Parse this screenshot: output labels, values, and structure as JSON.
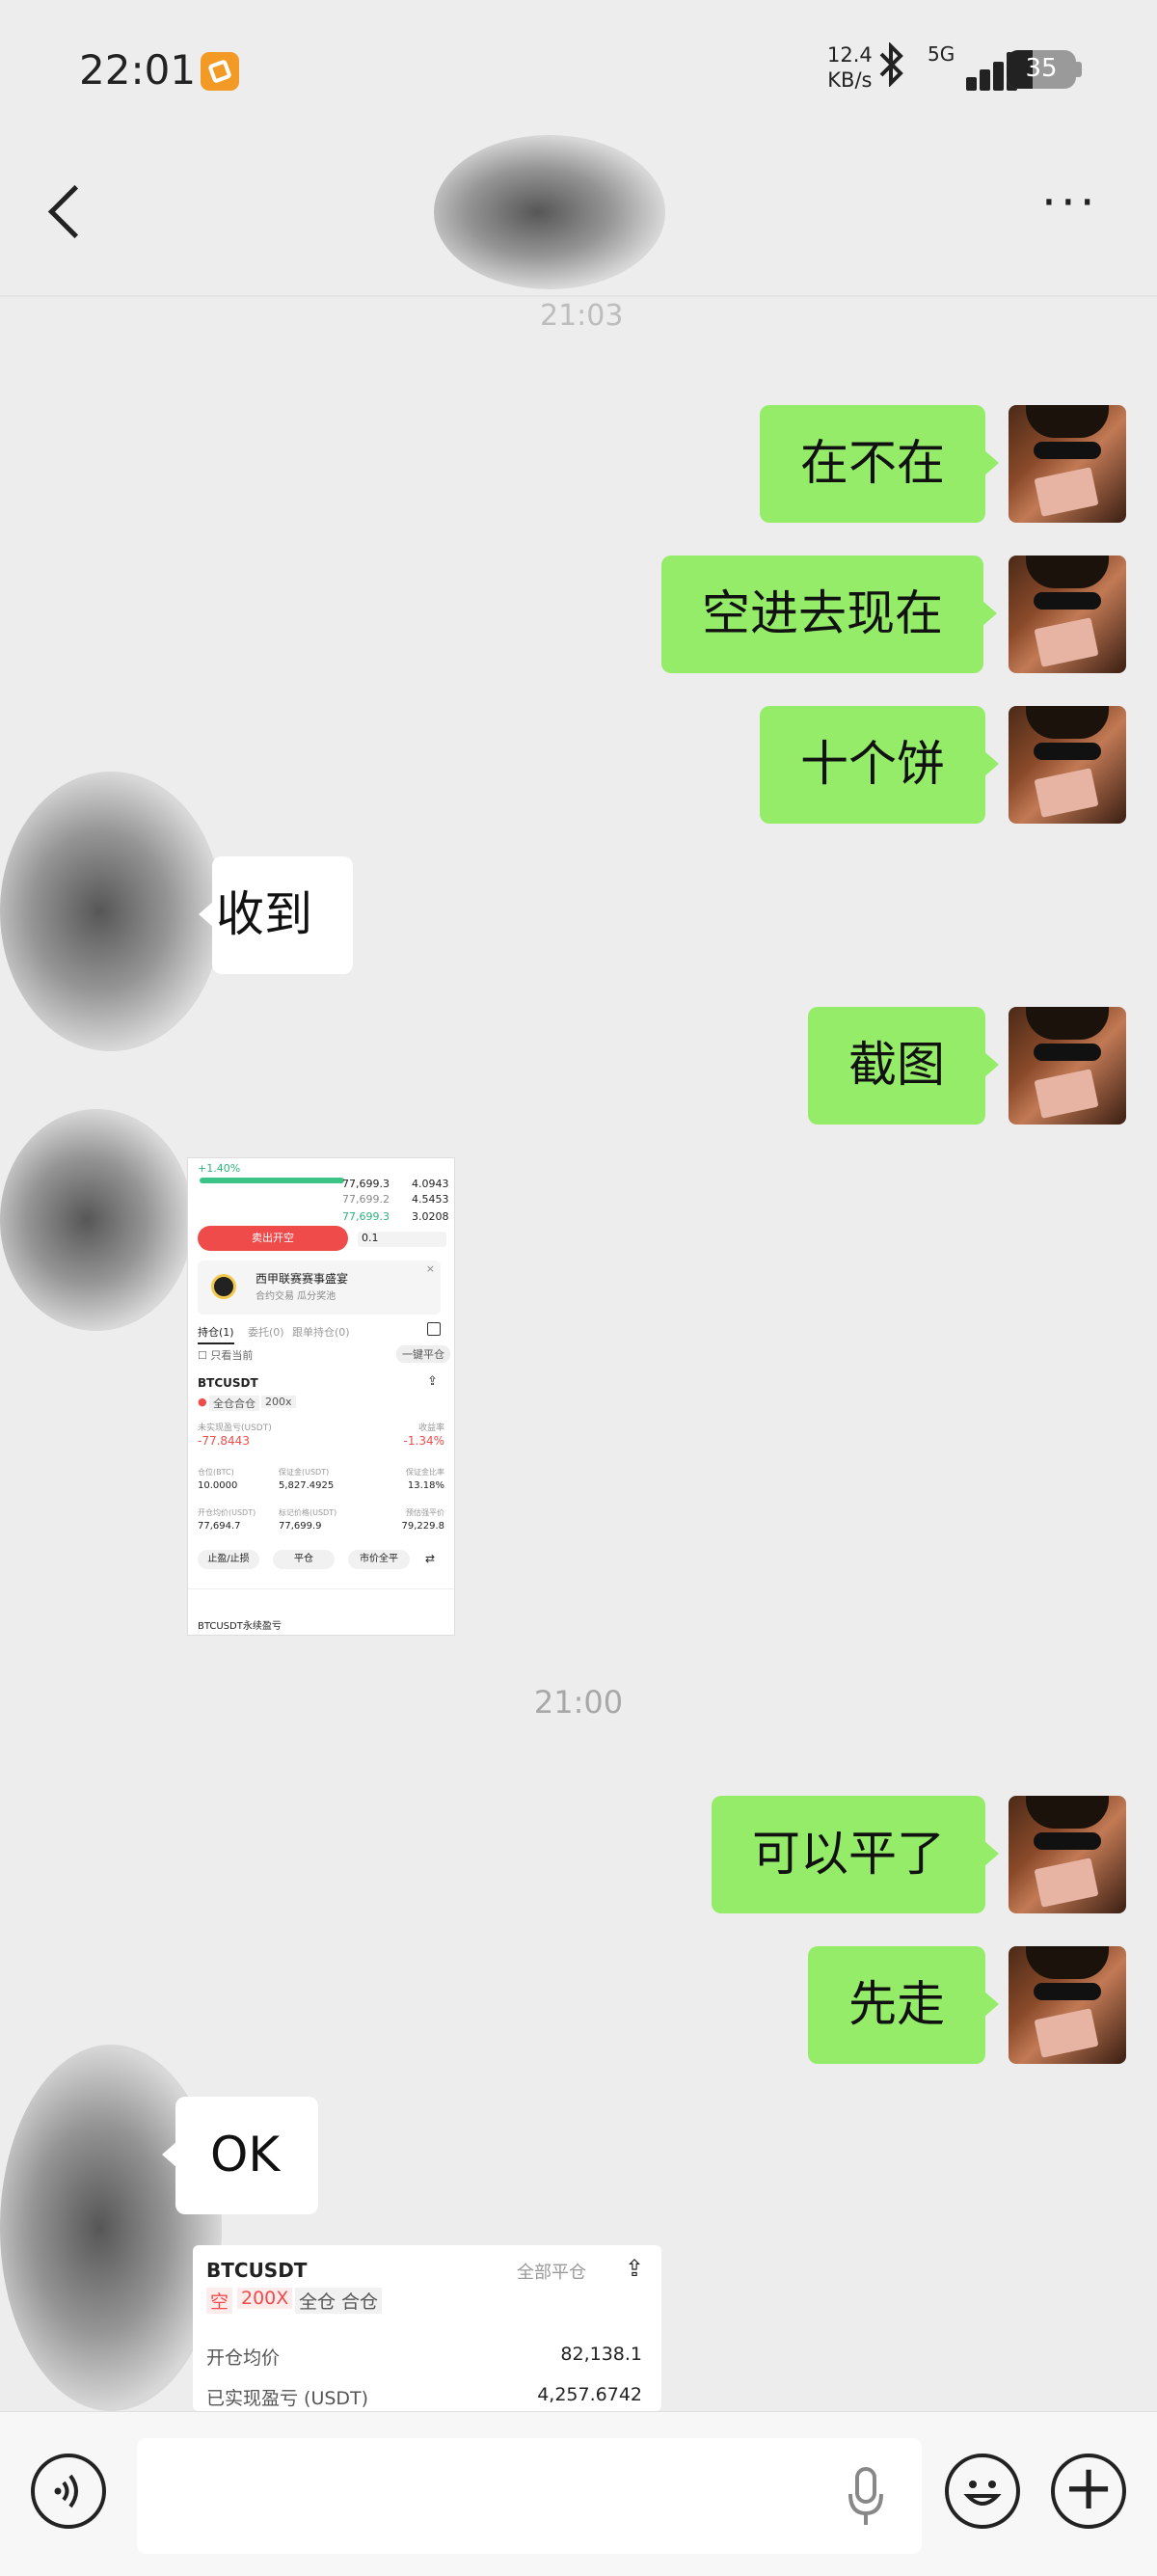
{
  "status_bar": {
    "time": "22:01",
    "net_speed_value": "12.4",
    "net_speed_unit": "KB/s",
    "network": "5G",
    "battery": "35"
  },
  "nav": {
    "more": "···"
  },
  "hidden_time": "21:03",
  "messages": [
    {
      "side": "sent",
      "text": "在不在"
    },
    {
      "side": "sent",
      "text": "空进去现在"
    },
    {
      "side": "sent",
      "text": "十个饼"
    },
    {
      "side": "recv",
      "text": "收到"
    },
    {
      "side": "sent",
      "text": "截图"
    },
    {
      "side": "sent",
      "text": "可以平了"
    },
    {
      "side": "sent",
      "text": "先走"
    },
    {
      "side": "recv",
      "text": "OK"
    }
  ],
  "timestamp": "21:00",
  "screenshot1": {
    "change": "+1.40%",
    "order_book": [
      {
        "price": "77,699.3",
        "qty": "4.0943"
      },
      {
        "price": "77,699.2",
        "qty": "4.5453"
      },
      {
        "price": "77,699.3",
        "qty": "3.0208"
      }
    ],
    "sell_button": "卖出开空",
    "amount": "0.1",
    "promo_title": "西甲联赛赛事盛宴",
    "promo_sub": "合约交易 瓜分奖池",
    "tab_positions": "持仓(1)",
    "tab_orders": "委托(0)",
    "tab_plan": "跟单持仓(0)",
    "hide_others": "只看当前",
    "close_all": "一键平仓",
    "symbol": "BTCUSDT",
    "tag_cross": "全仓合仓",
    "tag_leverage": "200x",
    "pnl_label": "未实现盈亏(USDT)",
    "pnl_value": "-77.8443",
    "roe_label": "收益率",
    "roe_value": "-1.34%",
    "size_label": "仓位(BTC)",
    "size_value": "10.0000",
    "margin_label": "保证金(USDT)",
    "margin_value": "5,827.4925",
    "ratio_label": "保证金比率",
    "ratio_value": "13.18%",
    "entry_label": "开仓均价(USDT)",
    "entry_value": "77,694.7",
    "mark_label": "标记价格(USDT)",
    "mark_value": "77,699.9",
    "liq_label": "预估强平价",
    "liq_value": "79,229.8",
    "btn_tpsl": "止盈/止损",
    "btn_close": "平仓",
    "btn_market": "市价全平",
    "footer": "BTCUSDT永续盈亏"
  },
  "screenshot2": {
    "symbol": "BTCUSDT",
    "close_all": "全部平仓",
    "tag_side": "空",
    "tag_leverage": "200X",
    "tag_mode": "全仓 合仓",
    "entry_label": "开仓均价",
    "entry_value": "82,138.1",
    "realized_label": "已实现盈亏 (USDT)",
    "realized_value": "4,257.6742"
  },
  "icons": [
    "back-icon",
    "more-icon",
    "voice-icon",
    "mic-icon",
    "emoji-icon",
    "plus-icon",
    "share-icon"
  ]
}
